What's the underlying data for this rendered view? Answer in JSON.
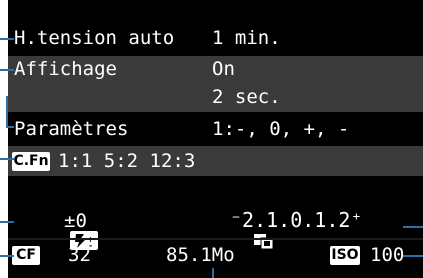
{
  "menu": {
    "auto_power_off": {
      "label": "H.tension auto",
      "value": "1 min."
    },
    "display": {
      "label": "Affichage",
      "value_on": "On",
      "value_time": "2 sec."
    },
    "parameters": {
      "label": "Paramètres",
      "value": "1:-, 0, +, -"
    }
  },
  "custom_functions": {
    "badge": "C.Fn",
    "values": "1:1 5:2 12:3"
  },
  "flash_comp": {
    "value": "±0"
  },
  "exposure_scale": {
    "value": "⁻2.1.0.1.2⁺"
  },
  "card": {
    "badge": "CF",
    "shots": "32",
    "size": "85.1Mo"
  },
  "iso": {
    "badge": "ISO",
    "value": "100"
  },
  "colors": {
    "screen_bg": "#000000",
    "highlight": "#3a3a3a",
    "text": "#ffffff",
    "leader_lines": "#2a6fa6"
  }
}
